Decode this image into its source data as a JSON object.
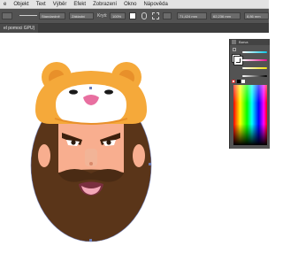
{
  "menubar": {
    "items": [
      "e",
      "Objekt",
      "Text",
      "Výběr",
      "Efekt",
      "Zobrazení",
      "Okno",
      "Nápověda"
    ]
  },
  "controlbar": {
    "stroke_style": "Standardně",
    "brush": "Základní",
    "opacity_label": "Kryti:",
    "opacity_value": "100%",
    "x_value": "71,424 mm",
    "y_value": "62,236 mm",
    "w_value": "8,86 mm"
  },
  "document_tab": {
    "label": "el pomoci GPU)"
  },
  "color_panel": {
    "title": "Barva"
  },
  "colors": {
    "hat": "#f5a93a",
    "hat_mask": "#ffffff",
    "nose_pink": "#e86fa0",
    "beard": "#5a3519",
    "skin": "#f8ae8f",
    "eyebrow": "#3d200d",
    "tongue": "#f3a7b7",
    "ui_dark": "#535353"
  }
}
